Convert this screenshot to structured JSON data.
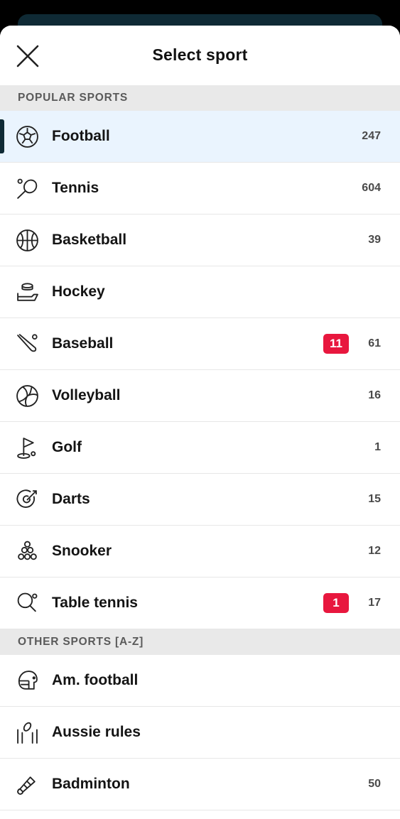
{
  "header": {
    "title": "Select sport"
  },
  "sections": [
    {
      "title": "POPULAR SPORTS",
      "items": [
        {
          "name": "Football",
          "icon": "football-icon",
          "count": "247",
          "live": "",
          "selected": true
        },
        {
          "name": "Tennis",
          "icon": "tennis-icon",
          "count": "604",
          "live": ""
        },
        {
          "name": "Basketball",
          "icon": "basketball-icon",
          "count": "39",
          "live": ""
        },
        {
          "name": "Hockey",
          "icon": "hockey-icon",
          "count": "",
          "live": ""
        },
        {
          "name": "Baseball",
          "icon": "baseball-icon",
          "count": "61",
          "live": "11"
        },
        {
          "name": "Volleyball",
          "icon": "volleyball-icon",
          "count": "16",
          "live": ""
        },
        {
          "name": "Golf",
          "icon": "golf-icon",
          "count": "1",
          "live": ""
        },
        {
          "name": "Darts",
          "icon": "darts-icon",
          "count": "15",
          "live": ""
        },
        {
          "name": "Snooker",
          "icon": "snooker-icon",
          "count": "12",
          "live": ""
        },
        {
          "name": "Table tennis",
          "icon": "table-tennis-icon",
          "count": "17",
          "live": "1"
        }
      ]
    },
    {
      "title": "OTHER SPORTS [A-Z]",
      "items": [
        {
          "name": "Am. football",
          "icon": "american-football-icon",
          "count": "",
          "live": ""
        },
        {
          "name": "Aussie rules",
          "icon": "aussie-rules-icon",
          "count": "",
          "live": ""
        },
        {
          "name": "Badminton",
          "icon": "badminton-icon",
          "count": "50",
          "live": ""
        }
      ]
    }
  ],
  "colors": {
    "accent": "#0f2a35",
    "live_badge": "#e8173e",
    "selected_bg": "#eaf4fe"
  }
}
